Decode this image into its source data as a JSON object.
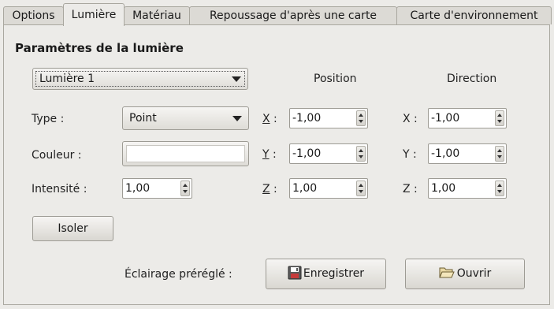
{
  "tabs": [
    {
      "label": "Options",
      "active": false
    },
    {
      "label": "Lumière",
      "active": true
    },
    {
      "label": "Matériau",
      "active": false
    },
    {
      "label": "Repoussage d'après une carte",
      "active": false
    },
    {
      "label": "Carte d'environnement",
      "active": false
    }
  ],
  "light": {
    "section_title": "Paramètres de la lumière",
    "light_select": "Lumière 1",
    "type_label": "Type :",
    "type_value": "Point",
    "color_label": "Couleur :",
    "color_value": "#ffffff",
    "intensity_label": "Intensité :",
    "intensity_value": "1,00",
    "isolate_button": "Isoler"
  },
  "position": {
    "header": "Position",
    "x_label": "X :",
    "x_value": "-1,00",
    "y_label": "Y :",
    "y_value": "-1,00",
    "z_label": "Z :",
    "z_value": "1,00"
  },
  "direction": {
    "header": "Direction",
    "x_label": "X :",
    "x_value": "-1,00",
    "y_label": "Y :",
    "y_value": "-1,00",
    "z_label": "Z :",
    "z_value": "1,00"
  },
  "presets": {
    "label": "Éclairage préréglé :",
    "save_button": "Enregistrer",
    "open_button": "Ouvrir"
  },
  "icons": {
    "save": "floppy-disk-icon",
    "open": "folder-open-icon"
  }
}
